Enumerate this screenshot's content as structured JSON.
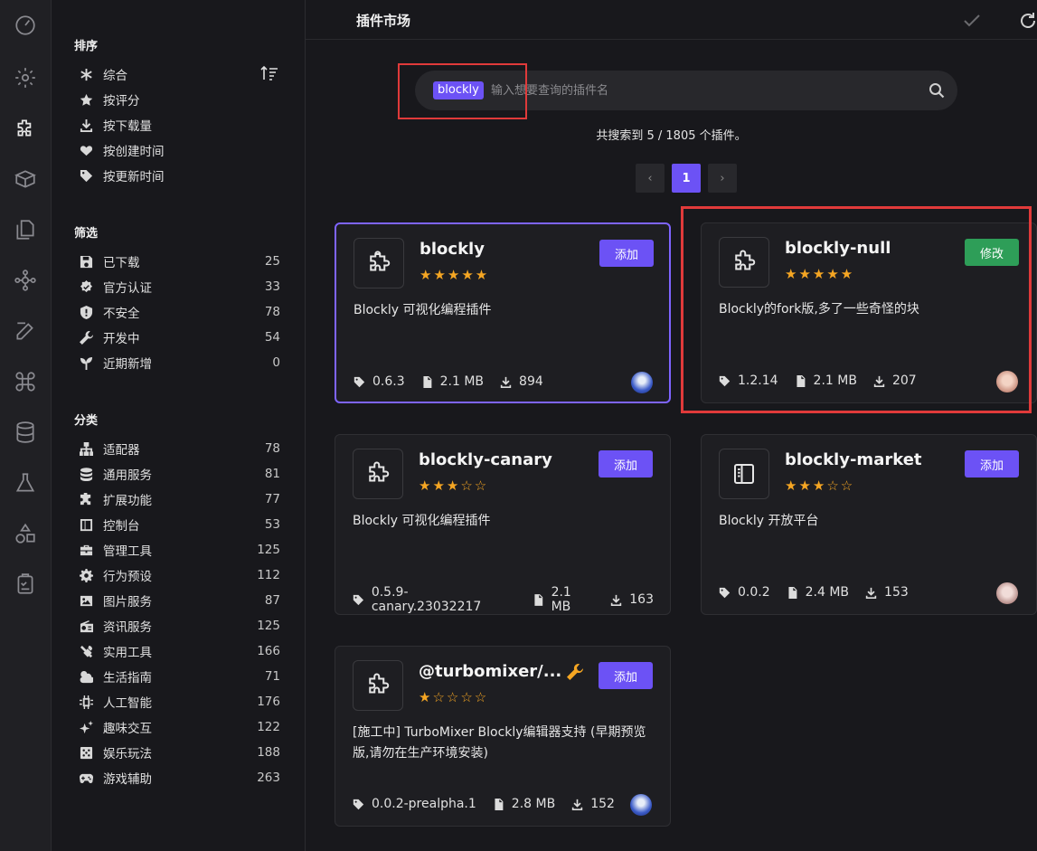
{
  "header": {
    "title": "插件市场"
  },
  "sidebar": {
    "sort": {
      "title": "排序",
      "items": [
        {
          "label": "综合",
          "icon": "asterisk-icon"
        },
        {
          "label": "按评分",
          "icon": "star-icon"
        },
        {
          "label": "按下载量",
          "icon": "download-icon"
        },
        {
          "label": "按创建时间",
          "icon": "heart-pulse-icon"
        },
        {
          "label": "按更新时间",
          "icon": "tag-icon"
        }
      ]
    },
    "filter": {
      "title": "筛选",
      "items": [
        {
          "label": "已下载",
          "count": "25",
          "icon": "save-icon"
        },
        {
          "label": "官方认证",
          "count": "33",
          "icon": "verified-icon"
        },
        {
          "label": "不安全",
          "count": "78",
          "icon": "shield-alert-icon"
        },
        {
          "label": "开发中",
          "count": "54",
          "icon": "wrench-icon"
        },
        {
          "label": "近期新增",
          "count": "0",
          "icon": "sprout-icon"
        }
      ]
    },
    "category": {
      "title": "分类",
      "items": [
        {
          "label": "适配器",
          "count": "78",
          "icon": "hierarchy-icon"
        },
        {
          "label": "通用服务",
          "count": "81",
          "icon": "database-icon"
        },
        {
          "label": "扩展功能",
          "count": "77",
          "icon": "puzzle-icon"
        },
        {
          "label": "控制台",
          "count": "53",
          "icon": "sidebar-icon"
        },
        {
          "label": "管理工具",
          "count": "125",
          "icon": "toolbox-icon"
        },
        {
          "label": "行为预设",
          "count": "112",
          "icon": "cog-icon"
        },
        {
          "label": "图片服务",
          "count": "87",
          "icon": "image-icon"
        },
        {
          "label": "资讯服务",
          "count": "125",
          "icon": "radio-icon"
        },
        {
          "label": "实用工具",
          "count": "166",
          "icon": "tools-icon"
        },
        {
          "label": "生活指南",
          "count": "71",
          "icon": "weather-icon"
        },
        {
          "label": "人工智能",
          "count": "176",
          "icon": "chip-icon"
        },
        {
          "label": "趣味交互",
          "count": "122",
          "icon": "sparkles-icon"
        },
        {
          "label": "娱乐玩法",
          "count": "188",
          "icon": "dice-icon"
        },
        {
          "label": "游戏辅助",
          "count": "263",
          "icon": "gamepad-icon"
        }
      ]
    }
  },
  "search": {
    "chip": "blockly",
    "placeholder": "输入想要查询的插件名"
  },
  "result": {
    "text": "共搜索到 5 / 1805 个插件。"
  },
  "pagination": {
    "prev": "‹",
    "current": "1",
    "next": "›"
  },
  "cards": [
    {
      "name": "blockly",
      "rating": 5,
      "stars": "★★★★★",
      "button": "添加",
      "description": "Blockly 可视化编程插件",
      "version": "0.6.3",
      "size": "2.1 MB",
      "downloads": "894"
    },
    {
      "name": "blockly-null",
      "rating": 5,
      "stars": "★★★★★",
      "button": "修改",
      "description": "Blockly的fork版,多了一些奇怪的块",
      "version": "1.2.14",
      "size": "2.1 MB",
      "downloads": "207"
    },
    {
      "name": "blockly-canary",
      "rating": 3,
      "stars": "★★★☆☆",
      "button": "添加",
      "description": "Blockly 可视化编程插件",
      "version": "0.5.9-canary.23032217",
      "size": "2.1 MB",
      "downloads": "163"
    },
    {
      "name": "blockly-market",
      "rating": 3,
      "stars": "★★★☆☆",
      "button": "添加",
      "description": "Blockly 开放平台",
      "version": "0.0.2",
      "size": "2.4 MB",
      "downloads": "153"
    },
    {
      "name": "@turbomixer/...",
      "rating": 1,
      "stars": "★☆☆☆☆",
      "button": "添加",
      "description": "[施工中] TurboMixer Blockly编辑器支持 (早期预览版,请勿在生产环境安装)",
      "version": "0.0.2-prealpha.1",
      "size": "2.8 MB",
      "downloads": "152"
    }
  ],
  "colors": {
    "accent": "#6c52f5",
    "edit": "#2e9e58",
    "star": "#f5a623",
    "highlight": "#e03a3a"
  }
}
